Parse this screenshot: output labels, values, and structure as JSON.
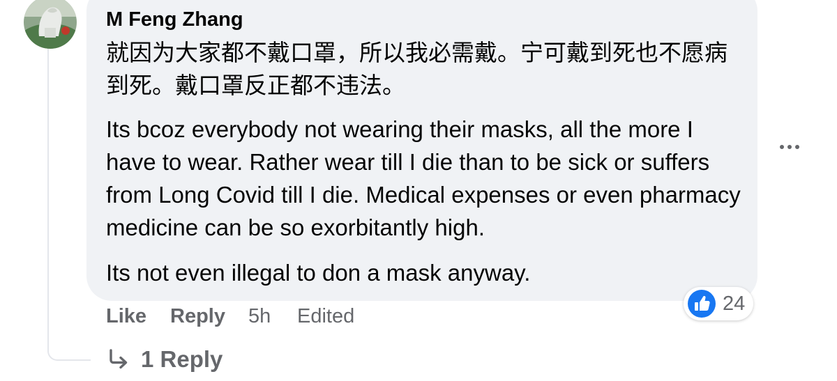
{
  "comment": {
    "author": "M Feng Zhang",
    "paragraphs": {
      "chinese": "就因为大家都不戴口罩，所以我必需戴。宁可戴到死也不愿病到死。戴口罩反正都不违法。",
      "english_1": "Its bcoz everybody not wearing their masks, all the more I have to wear. Rather wear till I die than to be sick or suffers from Long Covid till I die. Medical expenses or even pharmacy medicine can be so exorbitantly high.",
      "english_2": "Its not even illegal to don a mask anyway."
    },
    "reactions": {
      "icon": "like-icon",
      "count": "24",
      "color": "#1877f2"
    },
    "actions": {
      "like": "Like",
      "reply": "Reply",
      "time": "5h",
      "edited": "Edited"
    },
    "replies_link": "1 Reply"
  },
  "colors": {
    "bubble": "#f0f2f5",
    "text": "#050505",
    "secondary": "#65676b",
    "accent": "#1877f2"
  }
}
